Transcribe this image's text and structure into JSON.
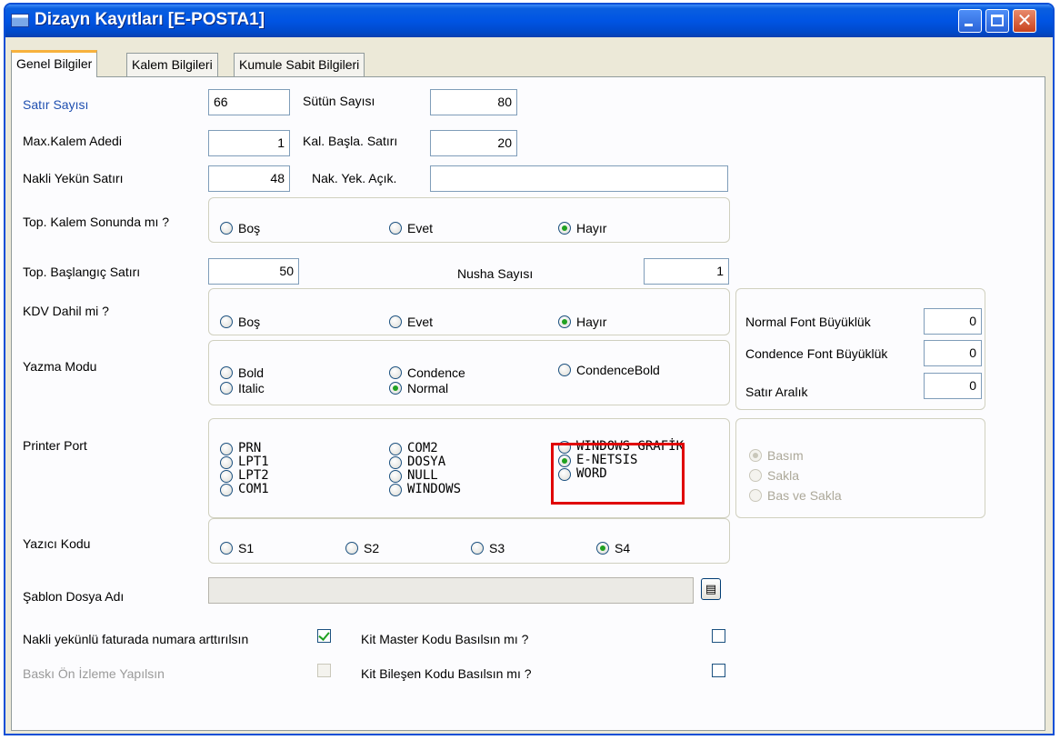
{
  "window": {
    "title": "Dizayn Kayıtları [E-POSTA1]"
  },
  "tabs": [
    {
      "label": "Genel Bilgiler",
      "active": true
    },
    {
      "label": "Kalem Bilgileri",
      "active": false
    },
    {
      "label": "Kumule Sabit Bilgileri",
      "active": false
    }
  ],
  "fields": {
    "satir_sayisi": {
      "label": "Satır Sayısı",
      "value": "66"
    },
    "sutun_sayisi": {
      "label": "Sütün Sayısı",
      "value": "80"
    },
    "max_kalem_adedi": {
      "label": "Max.Kalem Adedi",
      "value": "1"
    },
    "kal_basla_satiri": {
      "label": "Kal. Başla. Satırı",
      "value": "20"
    },
    "nakli_yekun_satiri": {
      "label": "Nakli Yekün Satırı",
      "value": "48"
    },
    "nak_yek_acik": {
      "label": "Nak. Yek. Açık.",
      "value": ""
    },
    "top_baslangic_satiri": {
      "label": "Top. Başlangıç Satırı",
      "value": "50"
    },
    "nusha_sayisi": {
      "label": "Nusha Sayısı",
      "value": "1"
    },
    "normal_font": {
      "label": "Normal Font Büyüklük",
      "value": "0"
    },
    "condence_font": {
      "label": "Condence Font Büyüklük",
      "value": "0"
    },
    "satir_aralik": {
      "label": "Satır Aralık",
      "value": "0"
    },
    "sablon_dosya": {
      "label": "Şablon Dosya Adı",
      "value": ""
    }
  },
  "top_kalem_sonunda": {
    "label": "Top. Kalem Sonunda mı ?",
    "options": [
      "Boş",
      "Evet",
      "Hayır"
    ],
    "selected": "Hayır"
  },
  "kdv_dahil": {
    "label": "KDV Dahil mi ?",
    "options": [
      "Boş",
      "Evet",
      "Hayır"
    ],
    "selected": "Hayır"
  },
  "yazma_modu": {
    "label": "Yazma Modu",
    "options": [
      "Bold",
      "Italic",
      "Condence",
      "Normal",
      "CondenceBold"
    ],
    "selected": "Normal"
  },
  "printer_port": {
    "label": "Printer Port",
    "options": [
      "PRN",
      "LPT1",
      "LPT2",
      "COM1",
      "COM2",
      "DOSYA",
      "NULL",
      "WINDOWS",
      "WINDOWS GRAFİK",
      "E-NETSIS",
      "WORD"
    ],
    "selected": "E-NETSIS"
  },
  "basim_mode": {
    "options": [
      "Basım",
      "Sakla",
      "Bas ve Sakla"
    ],
    "selected": "Basım"
  },
  "yazici_kodu": {
    "label": "Yazıcı Kodu",
    "options": [
      "S1",
      "S2",
      "S3",
      "S4"
    ],
    "selected": "S4"
  },
  "checks": {
    "nakli_yekun_arttir": {
      "label": "Nakli yekünlü faturada numara arttırılsın",
      "checked": true
    },
    "kit_master": {
      "label": "Kit Master Kodu Basılsın mı ?",
      "checked": false
    },
    "baski_onizleme": {
      "label": "Baskı Ön İzleme Yapılsın",
      "checked": false
    },
    "kit_bilesen": {
      "label": "Kit Bileşen Kodu Basılsın mı ?",
      "checked": false
    }
  }
}
